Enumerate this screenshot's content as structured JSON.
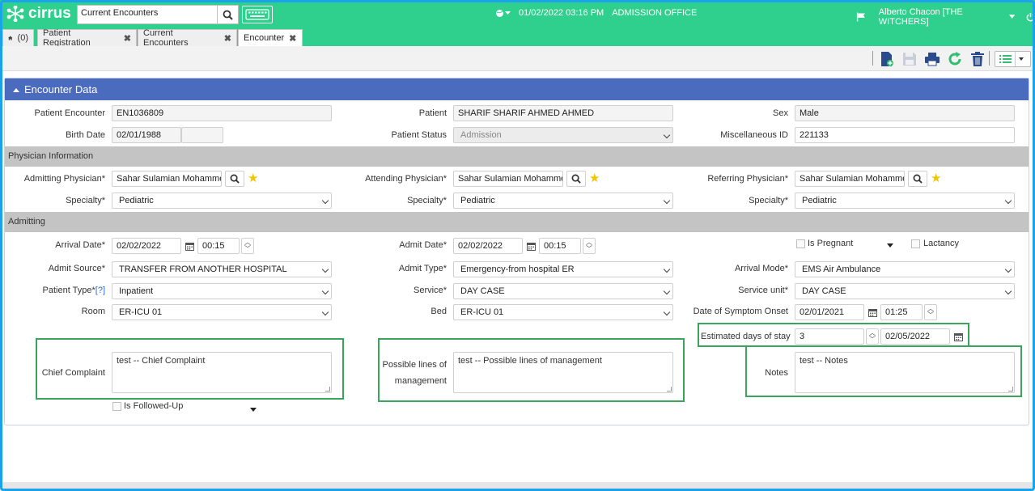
{
  "app": {
    "brand": "cirrus",
    "search_value": "Current Encounters",
    "datetime": "01/02/2022 03:16 PM",
    "location": "ADMISSION OFFICE",
    "user": "Alberto Chacon [THE WITCHERS]"
  },
  "tabs": {
    "home_count": "(0)",
    "items": [
      {
        "label": "Patient Registration"
      },
      {
        "label": "Current Encounters"
      },
      {
        "label": "Encounter"
      }
    ]
  },
  "panel": {
    "title": "Encounter Data"
  },
  "encounter": {
    "patient_encounter_label": "Patient Encounter",
    "patient_encounter": "EN1036809",
    "patient_label": "Patient",
    "patient": "SHARIF SHARIF AHMED AHMED",
    "sex_label": "Sex",
    "sex": "Male",
    "birth_date_label": "Birth Date",
    "birth_date": "02/01/1988",
    "patient_status_label": "Patient Status",
    "patient_status": "Admission",
    "misc_id_label": "Miscellaneous ID",
    "misc_id": "221133"
  },
  "physician": {
    "section_title": "Physician Information",
    "admitting_label": "Admitting Physician*",
    "admitting": "Sahar Sulamian Mohammed",
    "attending_label": "Attending Physician*",
    "attending": "Sahar Sulamian Mohammed",
    "referring_label": "Referring Physician*",
    "referring": "Sahar Sulamian Mohammed",
    "specialty_label": "Specialty*",
    "specialty1": "Pediatric",
    "specialty2": "Pediatric",
    "specialty3": "Pediatric"
  },
  "admitting": {
    "section_title": "Admitting",
    "arrival_date_label": "Arrival Date*",
    "arrival_date": "02/02/2022",
    "arrival_time": "00:15",
    "admit_date_label": "Admit Date*",
    "admit_date": "02/02/2022",
    "admit_time": "00:15",
    "is_pregnant_label": "Is Pregnant",
    "lactancy_label": "Lactancy",
    "admit_source_label": "Admit Source*",
    "admit_source": "TRANSFER FROM ANOTHER HOSPITAL",
    "admit_type_label": "Admit Type*",
    "admit_type": "Emergency-from hospital ER",
    "arrival_mode_label": "Arrival Mode*",
    "arrival_mode": "EMS Air Ambulance",
    "patient_type_label": "Patient Type*",
    "patient_type_help": "[?]",
    "patient_type": "Inpatient",
    "service_label": "Service*",
    "service": "DAY CASE",
    "service_unit_label": "Service unit*",
    "service_unit": "DAY CASE",
    "room_label": "Room",
    "room": "ER-ICU 01",
    "bed_label": "Bed",
    "bed": "ER-ICU 01",
    "symptom_onset_label": "Date of Symptom Onset",
    "symptom_onset_date": "02/01/2021",
    "symptom_onset_time": "01:25",
    "est_days_label": "Estimated days of stay",
    "est_days": "3",
    "est_date": "02/05/2022",
    "chief_complaint_label": "Chief Complaint",
    "chief_complaint": "test -- Chief Complaint",
    "management_label_1": "Possible lines of",
    "management_label_2": "management",
    "management": "test -- Possible lines of management",
    "notes_label": "Notes",
    "notes": "test -- Notes",
    "followed_up_label": "Is Followed-Up"
  },
  "colors": {
    "topbar": "#2fd08e",
    "panel_header": "#4b6bbf",
    "section_bar": "#c4c4c4",
    "highlight": "#3aa55a",
    "frame": "#1aa3e8"
  }
}
